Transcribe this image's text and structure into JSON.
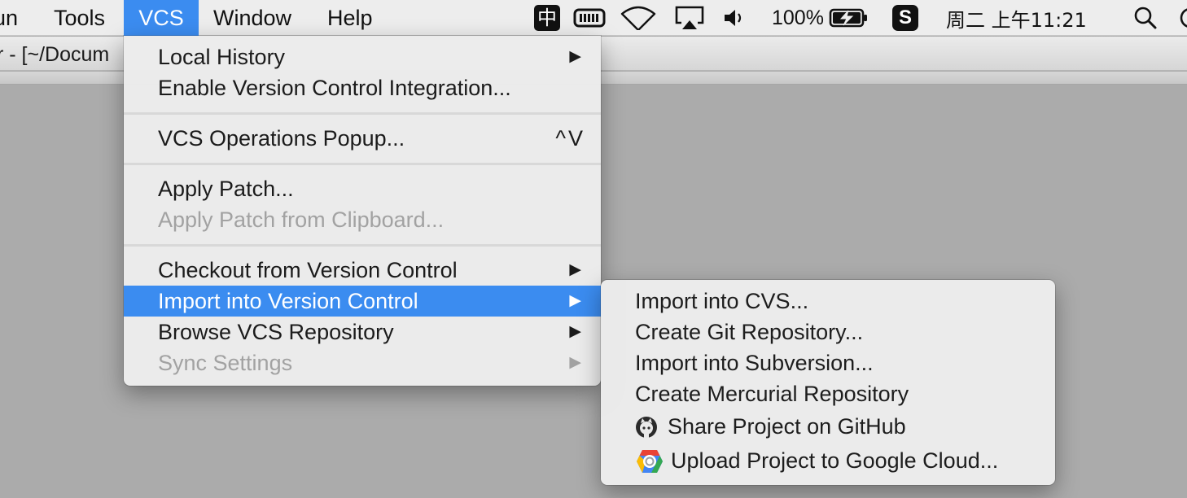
{
  "menubar": {
    "items": [
      "un",
      "Tools",
      "VCS",
      "Window",
      "Help"
    ],
    "active": "VCS",
    "status": {
      "input_method": "中",
      "battery_percent": "100%",
      "clock": "周二 上午11:21",
      "sogou": "S"
    }
  },
  "window": {
    "title": "r - [~/Docum"
  },
  "vcs_menu": {
    "local_history": "Local History",
    "enable_integration": "Enable Version Control Integration...",
    "operations_popup": "VCS Operations Popup...",
    "operations_shortcut": "^V",
    "apply_patch": "Apply Patch...",
    "apply_patch_clipboard": "Apply Patch from Clipboard...",
    "checkout": "Checkout from Version Control",
    "import": "Import into Version Control",
    "browse": "Browse VCS Repository",
    "sync": "Sync Settings"
  },
  "import_submenu": {
    "cvs": "Import into CVS...",
    "git": "Create Git Repository...",
    "svn": "Import into Subversion...",
    "hg": "Create Mercurial Repository",
    "github": "Share Project on GitHub",
    "gcloud": "Upload Project to Google Cloud..."
  },
  "icons": {
    "arrow": "submenu-arrow-icon",
    "github": "github-octocat-icon",
    "gcloud": "google-cloud-icon"
  },
  "colors": {
    "highlight": "#3b8cf0",
    "disabled_text": "#a2a2a2",
    "desktop_bg": "#ababab"
  }
}
